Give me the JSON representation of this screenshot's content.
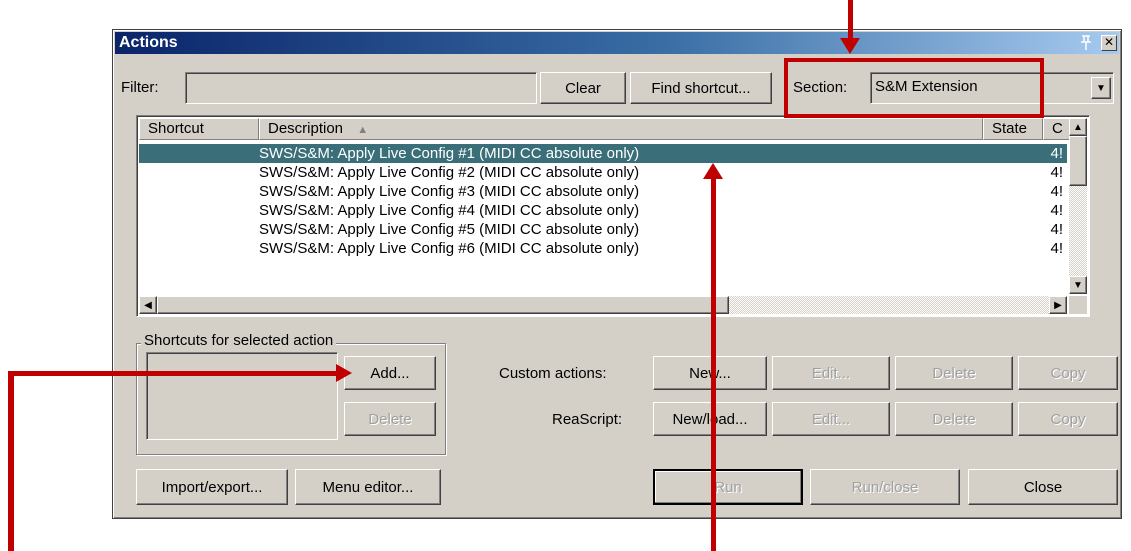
{
  "window": {
    "title": "Actions",
    "pin_icon": "pin-icon",
    "close_icon": "close-icon"
  },
  "filter": {
    "label": "Filter:",
    "value": "",
    "clear_label": "Clear",
    "find_shortcut_label": "Find shortcut..."
  },
  "section": {
    "label": "Section:",
    "value": "S&M Extension"
  },
  "table": {
    "columns": {
      "shortcut": "Shortcut",
      "description": "Description",
      "state": "State",
      "c": "C"
    },
    "rows": [
      {
        "shortcut": "",
        "description": "SWS/S&M: Apply Live Config #1 (MIDI CC absolute only)",
        "c": "4!"
      },
      {
        "shortcut": "",
        "description": "SWS/S&M: Apply Live Config #2 (MIDI CC absolute only)",
        "c": "4!"
      },
      {
        "shortcut": "",
        "description": "SWS/S&M: Apply Live Config #3 (MIDI CC absolute only)",
        "c": "4!"
      },
      {
        "shortcut": "",
        "description": "SWS/S&M: Apply Live Config #4 (MIDI CC absolute only)",
        "c": "4!"
      },
      {
        "shortcut": "",
        "description": "SWS/S&M: Apply Live Config #5 (MIDI CC absolute only)",
        "c": "4!"
      },
      {
        "shortcut": "",
        "description": "SWS/S&M: Apply Live Config #6 (MIDI CC absolute only)",
        "c": "4!"
      }
    ]
  },
  "shortcuts": {
    "group_label": "Shortcuts for selected action",
    "add_label": "Add...",
    "delete_label": "Delete"
  },
  "custom_actions": {
    "label": "Custom actions:",
    "new_label": "New...",
    "edit_label": "Edit...",
    "delete_label": "Delete",
    "copy_label": "Copy"
  },
  "reascript": {
    "label": "ReaScript:",
    "newload_label": "New/load...",
    "edit_label": "Edit...",
    "delete_label": "Delete",
    "copy_label": "Copy"
  },
  "bottom": {
    "import_export_label": "Import/export...",
    "menu_editor_label": "Menu editor...",
    "run_label": "Run",
    "run_close_label": "Run/close",
    "close_label": "Close"
  },
  "annotation": {
    "color": "#c00000"
  }
}
